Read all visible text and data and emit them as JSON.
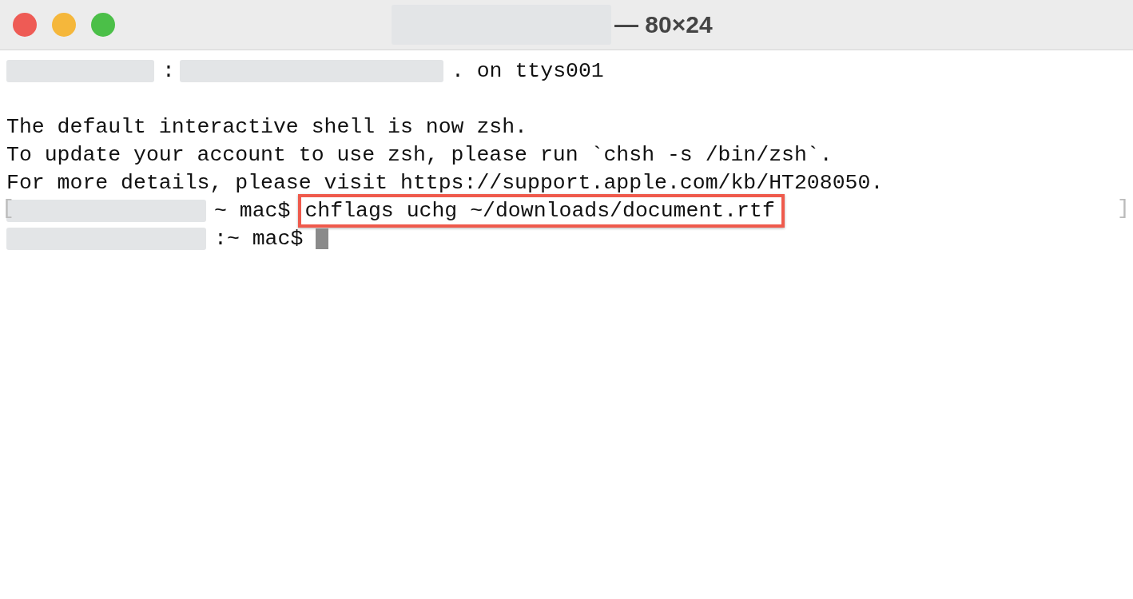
{
  "window": {
    "title_parts": [
      {
        "kind": "redacted_l"
      },
      {
        "kind": "text",
        "text": "— 80×24"
      }
    ]
  },
  "terminal": {
    "blocks": [
      {
        "lines": [
          {
            "segments": [
              {
                "kind": "redacted_s"
              },
              {
                "kind": "text",
                "text": ":"
              },
              {
                "kind": "redacted_l"
              },
              {
                "kind": "text",
                "text": ". on ttys001"
              }
            ]
          }
        ]
      },
      {
        "lines": [
          {
            "segments": [
              {
                "kind": "text",
                "text": "The default interactive shell is now zsh."
              }
            ]
          },
          {
            "segments": [
              {
                "kind": "text",
                "text": "To update your account to use zsh, please run `chsh -s /bin/zsh`."
              }
            ]
          },
          {
            "segments": [
              {
                "kind": "text",
                "text": "For more details, please visit https://support.apple.com/kb/HT208050."
              }
            ]
          },
          {
            "edge_marks": [
              "[",
              "]"
            ],
            "segments": [
              {
                "kind": "redacted_m"
              },
              {
                "kind": "text",
                "text": "~ mac$"
              },
              {
                "kind": "highlight",
                "text": "chflags uchg ~/downloads/document.rtf"
              }
            ]
          },
          {
            "segments": [
              {
                "kind": "redacted_m"
              },
              {
                "kind": "text",
                "text": ":~ mac$"
              },
              {
                "kind": "cursor"
              }
            ]
          }
        ]
      }
    ]
  }
}
